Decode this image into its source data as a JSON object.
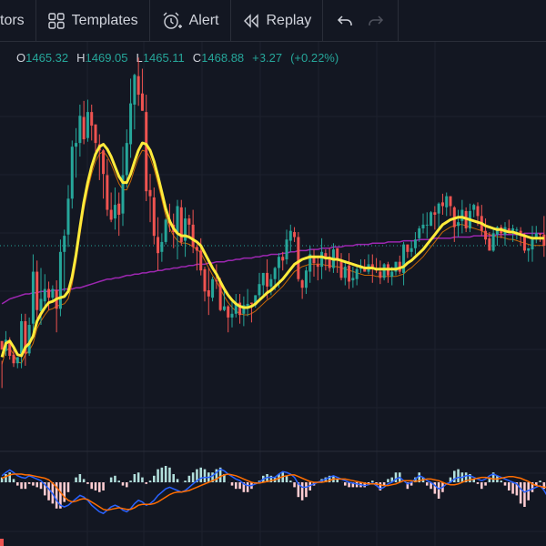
{
  "toolbar": {
    "indicators_label": "tors",
    "templates_label": "Templates",
    "alert_label": "Alert",
    "replay_label": "Replay",
    "templates_icon": "grid-icon",
    "alert_icon": "alarm-clock-plus-icon",
    "replay_icon": "rewind-icon",
    "undo_icon": "undo-icon",
    "redo_icon": "redo-icon"
  },
  "ohlc": {
    "o_label": "O",
    "o_value": "1465.32",
    "h_label": "H",
    "h_value": "1469.05",
    "l_label": "L",
    "l_value": "1465.11",
    "c_label": "C",
    "c_value": "1468.88",
    "change": "+3.27",
    "change_pct": "(+0.22%)"
  },
  "colors": {
    "background": "#131722",
    "up": "#26a69a",
    "down": "#ef5350",
    "ma_fast": "#ffeb3b",
    "ma_slow": "#9c27b0",
    "ichimoku_lead": "#f57c00",
    "ichimoku_base": "#3f51b5",
    "lagging": "#43a047",
    "macd_line": "#2962ff",
    "signal_line": "#ff6d00"
  },
  "chart_data": {
    "type": "candlestick",
    "candles": [
      [
        198,
        182,
        160,
        191
      ],
      [
        190,
        206,
        186,
        199
      ],
      [
        198,
        201,
        183,
        186
      ],
      [
        187,
        192,
        177,
        180
      ],
      [
        180,
        185,
        176,
        185
      ],
      [
        186,
        220,
        176,
        214
      ],
      [
        214,
        220,
        178,
        188
      ],
      [
        188,
        217,
        186,
        211
      ],
      [
        212,
        268,
        200,
        254
      ],
      [
        254,
        263,
        216,
        223
      ],
      [
        222,
        257,
        211,
        232
      ],
      [
        230,
        252,
        225,
        240
      ],
      [
        240,
        246,
        223,
        233
      ],
      [
        233,
        243,
        229,
        240
      ],
      [
        239,
        247,
        205,
        224
      ],
      [
        224,
        280,
        218,
        270
      ],
      [
        270,
        288,
        238,
        283
      ],
      [
        284,
        324,
        274,
        313
      ],
      [
        313,
        360,
        305,
        355
      ],
      [
        355,
        370,
        330,
        358
      ],
      [
        358,
        389,
        347,
        380
      ],
      [
        379,
        392,
        357,
        361
      ],
      [
        362,
        393,
        359,
        383
      ],
      [
        383,
        389,
        360,
        372
      ],
      [
        373,
        373,
        348,
        358
      ],
      [
        357,
        365,
        328,
        352
      ],
      [
        352,
        353,
        313,
        333
      ],
      [
        332,
        345,
        299,
        304
      ],
      [
        304,
        318,
        294,
        296
      ],
      [
        297,
        322,
        288,
        308
      ],
      [
        309,
        318,
        283,
        300
      ],
      [
        301,
        355,
        291,
        332
      ],
      [
        332,
        369,
        322,
        358
      ],
      [
        357,
        410,
        346,
        390
      ],
      [
        389,
        414,
        369,
        413
      ],
      [
        412,
        427,
        388,
        397
      ],
      [
        398,
        418,
        384,
        384
      ],
      [
        383,
        397,
        311,
        319
      ],
      [
        320,
        333,
        294,
        315
      ],
      [
        314,
        322,
        276,
        283
      ],
      [
        282,
        298,
        255,
        269
      ],
      [
        270,
        285,
        262,
        278
      ],
      [
        278,
        297,
        276,
        296
      ],
      [
        296,
        309,
        286,
        293
      ],
      [
        292,
        301,
        273,
        286
      ],
      [
        286,
        312,
        264,
        307
      ],
      [
        306,
        312,
        275,
        278
      ],
      [
        279,
        306,
        266,
        297
      ],
      [
        297,
        300,
        283,
        292
      ],
      [
        292,
        304,
        269,
        274
      ],
      [
        274,
        276,
        255,
        271
      ],
      [
        271,
        281,
        251,
        255
      ],
      [
        256,
        258,
        230,
        238
      ],
      [
        239,
        257,
        219,
        234
      ],
      [
        233,
        250,
        230,
        248
      ],
      [
        247,
        260,
        240,
        246
      ],
      [
        246,
        249,
        222,
        223
      ],
      [
        223,
        240,
        222,
        226
      ],
      [
        226,
        227,
        205,
        217
      ],
      [
        217,
        232,
        209,
        220
      ],
      [
        220,
        236,
        217,
        229
      ],
      [
        229,
        236,
        212,
        219
      ],
      [
        220,
        234,
        210,
        227
      ],
      [
        226,
        240,
        218,
        228
      ],
      [
        229,
        229,
        213,
        228
      ],
      [
        227,
        235,
        225,
        235
      ],
      [
        235,
        253,
        230,
        244
      ],
      [
        243,
        253,
        235,
        253
      ],
      [
        253,
        264,
        232,
        242
      ],
      [
        242,
        252,
        235,
        248
      ],
      [
        248,
        258,
        239,
        257
      ],
      [
        257,
        269,
        241,
        266
      ],
      [
        266,
        270,
        255,
        263
      ],
      [
        264,
        288,
        260,
        280
      ],
      [
        279,
        292,
        270,
        287
      ],
      [
        286,
        290,
        278,
        282
      ],
      [
        282,
        286,
        246,
        248
      ],
      [
        247,
        248,
        232,
        241
      ],
      [
        241,
        258,
        236,
        255
      ],
      [
        254,
        275,
        245,
        268
      ],
      [
        267,
        272,
        250,
        261
      ],
      [
        260,
        267,
        247,
        258
      ],
      [
        258,
        281,
        248,
        270
      ],
      [
        269,
        272,
        255,
        266
      ],
      [
        265,
        273,
        254,
        257
      ],
      [
        257,
        277,
        253,
        272
      ],
      [
        273,
        273,
        253,
        263
      ],
      [
        262,
        269,
        247,
        249
      ],
      [
        249,
        263,
        243,
        258
      ],
      [
        259,
        269,
        240,
        246
      ],
      [
        247,
        258,
        241,
        249
      ],
      [
        248,
        260,
        243,
        256
      ],
      [
        257,
        264,
        253,
        257
      ],
      [
        257,
        264,
        254,
        254
      ],
      [
        254,
        268,
        252,
        260
      ],
      [
        260,
        268,
        245,
        256
      ],
      [
        256,
        265,
        253,
        255
      ],
      [
        254,
        263,
        244,
        249
      ],
      [
        249,
        261,
        247,
        260
      ],
      [
        260,
        262,
        245,
        251
      ],
      [
        250,
        258,
        243,
        254
      ],
      [
        254,
        262,
        251,
        262
      ],
      [
        262,
        267,
        252,
        254
      ],
      [
        253,
        278,
        243,
        276
      ],
      [
        276,
        276,
        265,
        270
      ],
      [
        270,
        279,
        266,
        273
      ],
      [
        273,
        286,
        268,
        280
      ],
      [
        281,
        291,
        278,
        289
      ],
      [
        289,
        301,
        285,
        292
      ],
      [
        292,
        302,
        281,
        292
      ],
      [
        291,
        303,
        291,
        302
      ],
      [
        302,
        307,
        288,
        300
      ],
      [
        301,
        310,
        288,
        309
      ],
      [
        310,
        317,
        300,
        307
      ],
      [
        306,
        318,
        299,
        315
      ],
      [
        315,
        315,
        299,
        307
      ],
      [
        306,
        307,
        278,
        290
      ],
      [
        291,
        304,
        282,
        294
      ],
      [
        295,
        312,
        285,
        304
      ],
      [
        303,
        306,
        286,
        289
      ],
      [
        289,
        309,
        286,
        303
      ],
      [
        304,
        309,
        298,
        308
      ],
      [
        307,
        310,
        291,
        299
      ],
      [
        299,
        308,
        283,
        287
      ],
      [
        287,
        297,
        276,
        280
      ],
      [
        281,
        286,
        271,
        271
      ],
      [
        271,
        289,
        270,
        285
      ],
      [
        284,
        291,
        275,
        290
      ],
      [
        290,
        292,
        281,
        285
      ],
      [
        284,
        294,
        275,
        290
      ],
      [
        289,
        296,
        285,
        286
      ],
      [
        287,
        292,
        278,
        289
      ],
      [
        288,
        290,
        280,
        288
      ],
      [
        287,
        290,
        275,
        285
      ],
      [
        284,
        285,
        269,
        271
      ],
      [
        271,
        273,
        262,
        273
      ],
      [
        272,
        291,
        262,
        280
      ],
      [
        280,
        291,
        277,
        285
      ],
      [
        285,
        285,
        278,
        284
      ],
      [
        284,
        299,
        266,
        275
      ]
    ],
    "ma_fast": [
      185,
      196,
      198,
      193,
      187,
      186,
      193,
      196,
      202,
      214,
      220,
      225,
      229,
      230,
      232,
      233,
      234,
      238,
      250,
      268,
      290,
      310,
      326,
      339,
      349,
      355,
      357,
      353,
      347,
      339,
      331,
      326,
      326,
      333,
      343,
      352,
      358,
      357,
      352,
      343,
      331,
      318,
      305,
      295,
      289,
      285,
      283,
      283,
      282,
      280,
      278,
      275,
      269,
      263,
      257,
      252,
      246,
      240,
      235,
      231,
      228,
      226,
      225,
      225,
      226,
      228,
      231,
      234,
      237,
      239,
      242,
      245,
      248,
      252,
      256,
      260,
      262,
      264,
      265,
      266,
      266,
      266,
      266,
      265,
      265,
      264,
      264,
      263,
      262,
      261,
      260,
      259,
      258,
      257,
      257,
      257,
      256,
      256,
      256,
      256,
      256,
      256,
      257,
      258,
      261,
      263,
      266,
      269,
      272,
      276,
      280,
      284,
      288,
      292,
      294,
      296,
      297,
      298,
      298,
      297,
      296,
      295,
      294,
      293,
      291,
      290,
      289,
      288,
      288,
      287,
      286,
      286,
      285,
      284,
      283,
      282,
      281,
      281,
      281,
      281
    ],
    "ma_slow": [
      228,
      230,
      232,
      233,
      234,
      235,
      236,
      236,
      237,
      237,
      238,
      238,
      238,
      239,
      239,
      239,
      240,
      240,
      240,
      241,
      241,
      242,
      243,
      244,
      245,
      246,
      247,
      248,
      248,
      249,
      249,
      250,
      251,
      251,
      252,
      252,
      253,
      253,
      254,
      254,
      255,
      255,
      256,
      256,
      257,
      257,
      258,
      258,
      259,
      259,
      260,
      260,
      260,
      261,
      261,
      262,
      262,
      262,
      263,
      263,
      264,
      264,
      265,
      265,
      265,
      266,
      266,
      267,
      267,
      268,
      268,
      268,
      269,
      269,
      270,
      270,
      271,
      271,
      271,
      272,
      272,
      272,
      273,
      273,
      273,
      274,
      274,
      274,
      275,
      275,
      275,
      276,
      276,
      276,
      276,
      277,
      277,
      277,
      277,
      278,
      278,
      278,
      278,
      279,
      279,
      279,
      279,
      280,
      280,
      280,
      280,
      281,
      281,
      281,
      281,
      281,
      282,
      282,
      282,
      282,
      282,
      283,
      283,
      283,
      283,
      283,
      283,
      284,
      284,
      284,
      284,
      284,
      284,
      284,
      285,
      285,
      285,
      285,
      285,
      285
    ],
    "macd": [
      8,
      12,
      15,
      12,
      8,
      6,
      5,
      8,
      6,
      4,
      2,
      -3,
      -8,
      -14,
      -22,
      -28,
      -30,
      -28,
      -24,
      -20,
      -16,
      -18,
      -22,
      -28,
      -32,
      -36,
      -38,
      -34,
      -30,
      -28,
      -30,
      -34,
      -36,
      -32,
      -26,
      -22,
      -24,
      -28,
      -26,
      -22,
      -16,
      -12,
      -8,
      -6,
      -8,
      -10,
      -12,
      -10,
      -6,
      -2,
      2,
      5,
      6,
      6,
      8,
      12,
      16,
      14,
      10,
      7,
      4,
      2,
      -2,
      -4,
      -4,
      -2,
      0,
      4,
      6,
      6,
      6,
      10,
      13,
      12,
      10,
      6,
      -2,
      -6,
      -6,
      -4,
      -2,
      0,
      2,
      4,
      6,
      8,
      6,
      4,
      2,
      0,
      -1,
      -2,
      -3,
      -4,
      -3,
      -1,
      -4,
      -8,
      -6,
      -2,
      0,
      4,
      6,
      2,
      -2,
      0,
      4,
      8,
      6,
      2,
      0,
      -4,
      -8,
      -6,
      -2,
      0,
      4,
      6,
      6,
      8,
      8,
      6,
      4,
      2,
      4,
      8,
      10,
      8,
      6,
      4,
      2,
      0,
      -2,
      -8,
      -12,
      -10,
      -8,
      -6,
      -4,
      -10,
      -18
    ],
    "signal": [
      5,
      7,
      9,
      10,
      10,
      10,
      9,
      9,
      8,
      7,
      6,
      5,
      3,
      -1,
      -6,
      -12,
      -18,
      -22,
      -24,
      -23,
      -21,
      -20,
      -21,
      -24,
      -27,
      -30,
      -33,
      -34,
      -33,
      -32,
      -31,
      -32,
      -33,
      -33,
      -31,
      -28,
      -27,
      -27,
      -27,
      -26,
      -24,
      -21,
      -18,
      -15,
      -13,
      -12,
      -12,
      -11,
      -10,
      -8,
      -6,
      -4,
      -2,
      0,
      2,
      4,
      7,
      9,
      10,
      9,
      8,
      6,
      4,
      2,
      0,
      -1,
      -1,
      0,
      1,
      2,
      3,
      5,
      7,
      8,
      9,
      9,
      7,
      5,
      3,
      1,
      0,
      0,
      0,
      1,
      2,
      4,
      4,
      4,
      4,
      3,
      2,
      1,
      0,
      -1,
      -2,
      -2,
      -2,
      -3,
      -4,
      -4,
      -3,
      -2,
      0,
      2,
      2,
      2,
      1,
      2,
      3,
      4,
      4,
      3,
      2,
      0,
      -2,
      -3,
      -3,
      -2,
      0,
      2,
      3,
      4,
      5,
      6,
      6,
      5,
      4,
      4,
      5,
      6,
      7,
      7,
      6,
      5,
      3,
      1,
      -2,
      -4,
      -5,
      -6,
      -6,
      -6,
      -8
    ]
  }
}
